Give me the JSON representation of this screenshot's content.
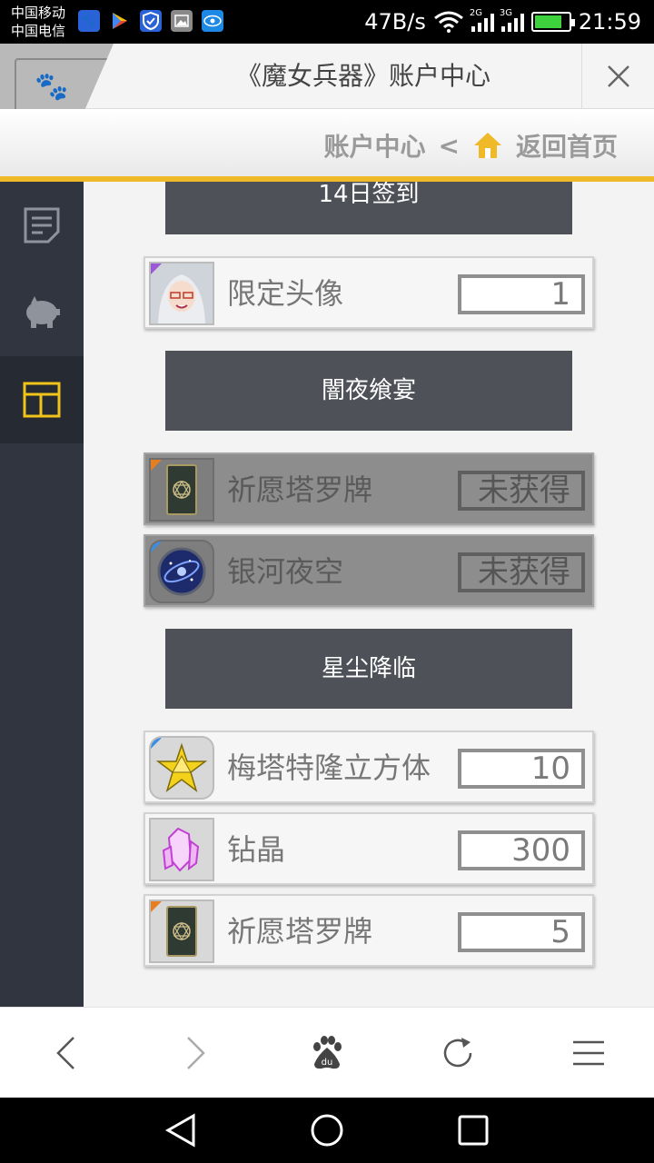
{
  "status_bar": {
    "carrier_1": "中国移动",
    "carrier_2": "中国电信",
    "app_icons": [
      "baidu-icon",
      "play-store-icon",
      "shield-icon",
      "gallery-icon",
      "eye-icon"
    ],
    "net_speed": "47B/s",
    "wifi_label": "2G",
    "cell_label": "3G",
    "time": "21:59",
    "battery_level": 0.8
  },
  "browser": {
    "page_title": "《魔女兵器》账户中心"
  },
  "site_header": {
    "breadcrumb_current": "账户中心",
    "breadcrumb_separator": "<",
    "home_link": "返回首页",
    "accent_color": "#f0b928"
  },
  "sidebar": {
    "items": [
      {
        "icon": "document-icon",
        "active": false
      },
      {
        "icon": "piggy-bank-icon",
        "active": false
      },
      {
        "icon": "layout-icon",
        "active": true
      }
    ]
  },
  "sections": [
    {
      "title": "14日签到",
      "items": [
        {
          "name": "限定头像",
          "count": "1",
          "locked": false,
          "icon": "avatar-icon"
        }
      ]
    },
    {
      "title": "闇夜飨宴",
      "items": [
        {
          "name": "祈愿塔罗牌",
          "count": "未获得",
          "locked": true,
          "icon": "tarot-card-icon"
        },
        {
          "name": "银河夜空",
          "count": "未获得",
          "locked": true,
          "icon": "galaxy-icon"
        }
      ]
    },
    {
      "title": "星尘降临",
      "items": [
        {
          "name": "梅塔特隆立方体",
          "count": "10",
          "locked": false,
          "icon": "star-cube-icon"
        },
        {
          "name": "钻晶",
          "count": "300",
          "locked": false,
          "icon": "crystal-icon"
        },
        {
          "name": "祈愿塔罗牌",
          "count": "5",
          "locked": false,
          "icon": "tarot-card-icon"
        }
      ]
    }
  ],
  "browser_toolbar": {
    "buttons": [
      "back-icon",
      "forward-icon",
      "baidu-home-icon",
      "refresh-icon",
      "menu-icon"
    ]
  },
  "nav_bar": {
    "buttons": [
      "nav-back-icon",
      "nav-home-icon",
      "nav-recents-icon"
    ]
  }
}
